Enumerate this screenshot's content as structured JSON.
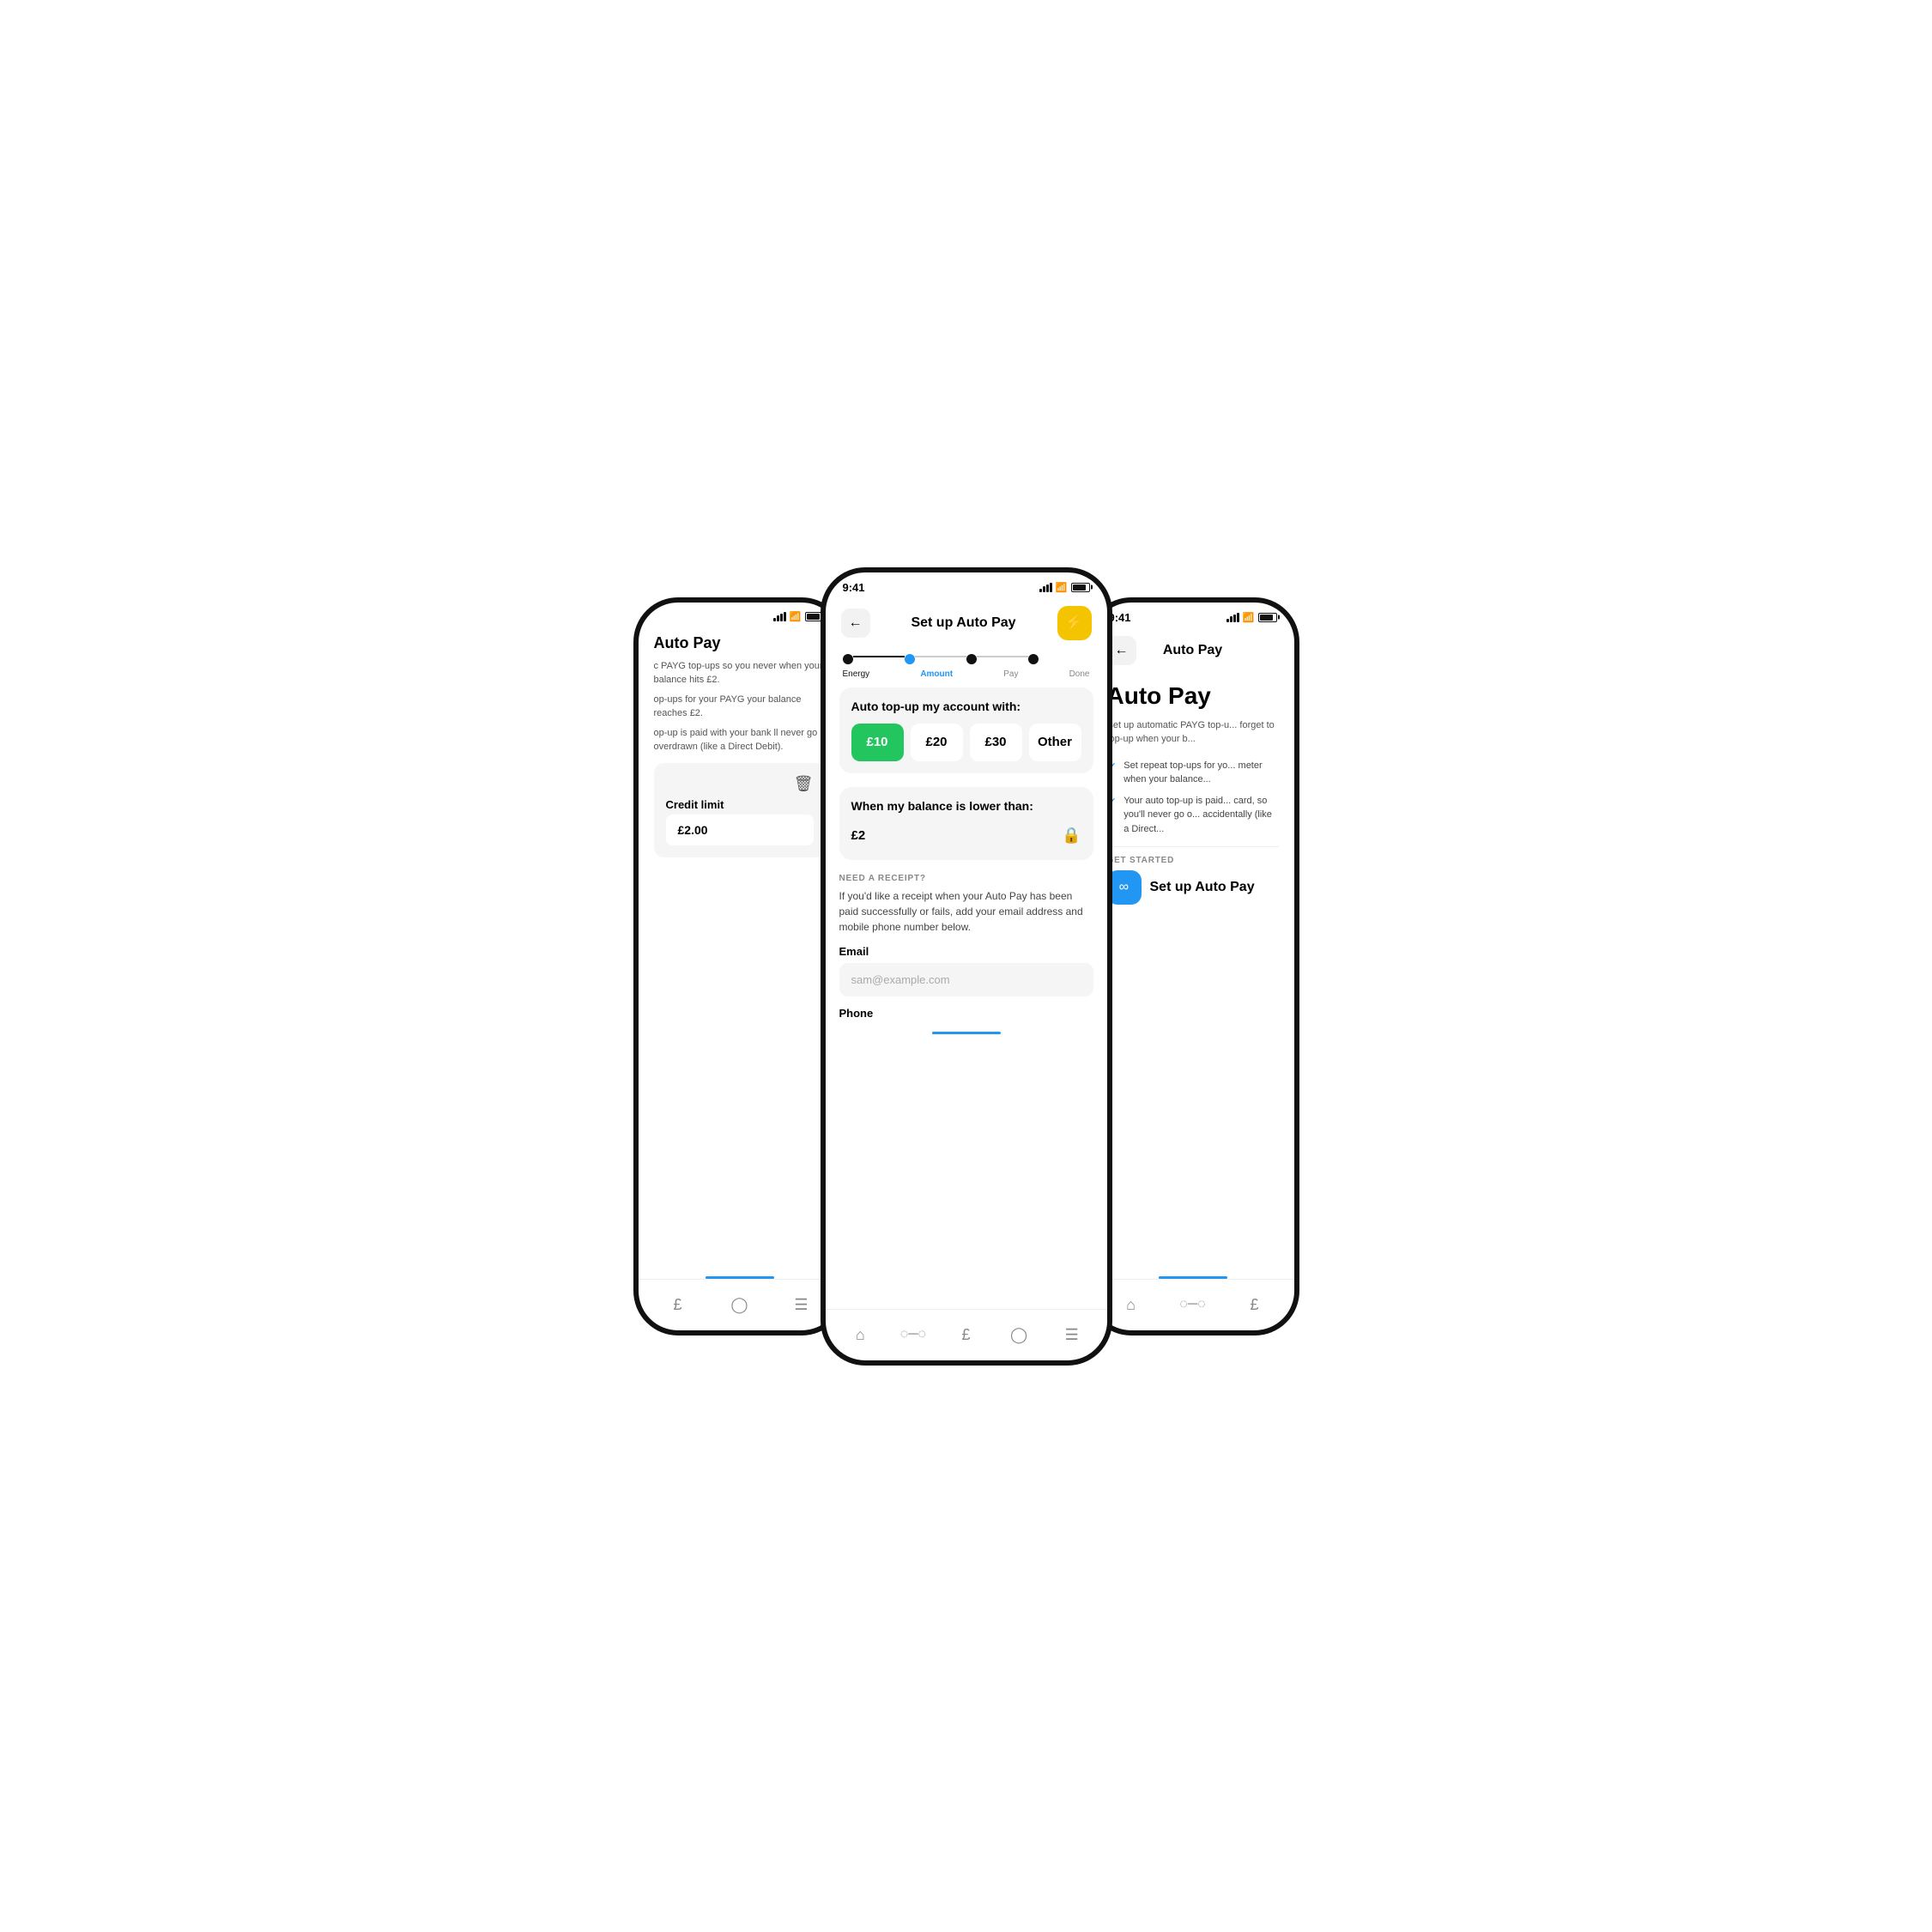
{
  "phones": {
    "left": {
      "title": "Auto Pay",
      "text1": "c PAYG top-ups so you never\nwhen your balance hits £2.",
      "text2": "op-ups for your PAYG\nyour balance reaches £2.",
      "text3": "op-up is paid with your bank\nll never go overdrawn\n(like a Direct Debit).",
      "credit_label": "Credit limit",
      "credit_value": "£2.00",
      "nav_items": [
        "£",
        "?",
        "≡"
      ],
      "nav_bar": true
    },
    "mid": {
      "time": "9:41",
      "header_title": "Set up Auto Pay",
      "back_label": "←",
      "steps": [
        {
          "label": "Energy",
          "state": "done"
        },
        {
          "label": "Amount",
          "state": "active"
        },
        {
          "label": "Pay",
          "state": "inactive"
        },
        {
          "label": "Done",
          "state": "inactive"
        }
      ],
      "card1_title": "Auto top-up my account with:",
      "amounts": [
        {
          "value": "£10",
          "selected": true
        },
        {
          "value": "£20",
          "selected": false
        },
        {
          "value": "£30",
          "selected": false
        },
        {
          "value": "Other",
          "selected": false
        }
      ],
      "card2_title": "When my balance is lower than:",
      "balance_value": "£2",
      "receipt_label": "NEED A RECEIPT?",
      "receipt_text": "If you'd like a receipt when your Auto Pay has\nbeen paid successfully or fails, add your email\naddress and mobile phone number below.",
      "email_label": "Email",
      "email_placeholder": "sam@example.com",
      "phone_label": "Phone",
      "nav_items": [
        "🏠",
        "∿",
        "£",
        "?",
        "≡"
      ],
      "nav_bar": true
    },
    "right": {
      "time": "9:41",
      "header_title": "Auto Pay",
      "back_label": "←",
      "main_title": "Auto Pay",
      "desc": "Set up automatic PAYG top-u...\nforget to top-up when your b...",
      "check1": "Set repeat top-ups for yo...\nmeter when your balance...",
      "check2": "Your auto top-up is paid...\ncard, so you'll never go o...\naccidentally (like a Direct...",
      "get_started_label": "GET STARTED",
      "setup_btn_label": "Set up Auto Pay",
      "nav_items": [
        "🏠",
        "∿",
        "£"
      ],
      "nav_bar": true
    }
  },
  "colors": {
    "accent_blue": "#2196F3",
    "accent_green": "#22C55E",
    "accent_yellow": "#F5C400",
    "bg": "#f5f5f5",
    "text_dark": "#111",
    "text_gray": "#888"
  }
}
